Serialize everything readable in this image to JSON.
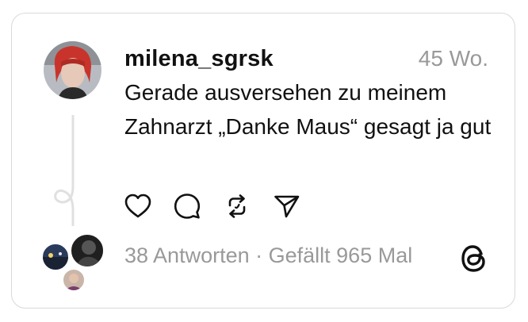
{
  "post": {
    "username": "milena_sgrsk",
    "time": "45 Wo.",
    "text": "Gerade ausversehen zu meinem Zahnarzt „Danke Maus“ gesagt ja gut"
  },
  "actions": {
    "like_icon": "heart-icon",
    "reply_icon": "comment-bubble-icon",
    "repost_icon": "repost-icon",
    "share_icon": "send-icon"
  },
  "stats": {
    "replies": "38 Antworten",
    "separator": " · ",
    "likes": "Gefällt 965 Mal"
  },
  "brand": {
    "logo": "threads-logo-icon"
  },
  "colors": {
    "text": "#111111",
    "muted": "#999999",
    "border": "#d9d9d9"
  }
}
